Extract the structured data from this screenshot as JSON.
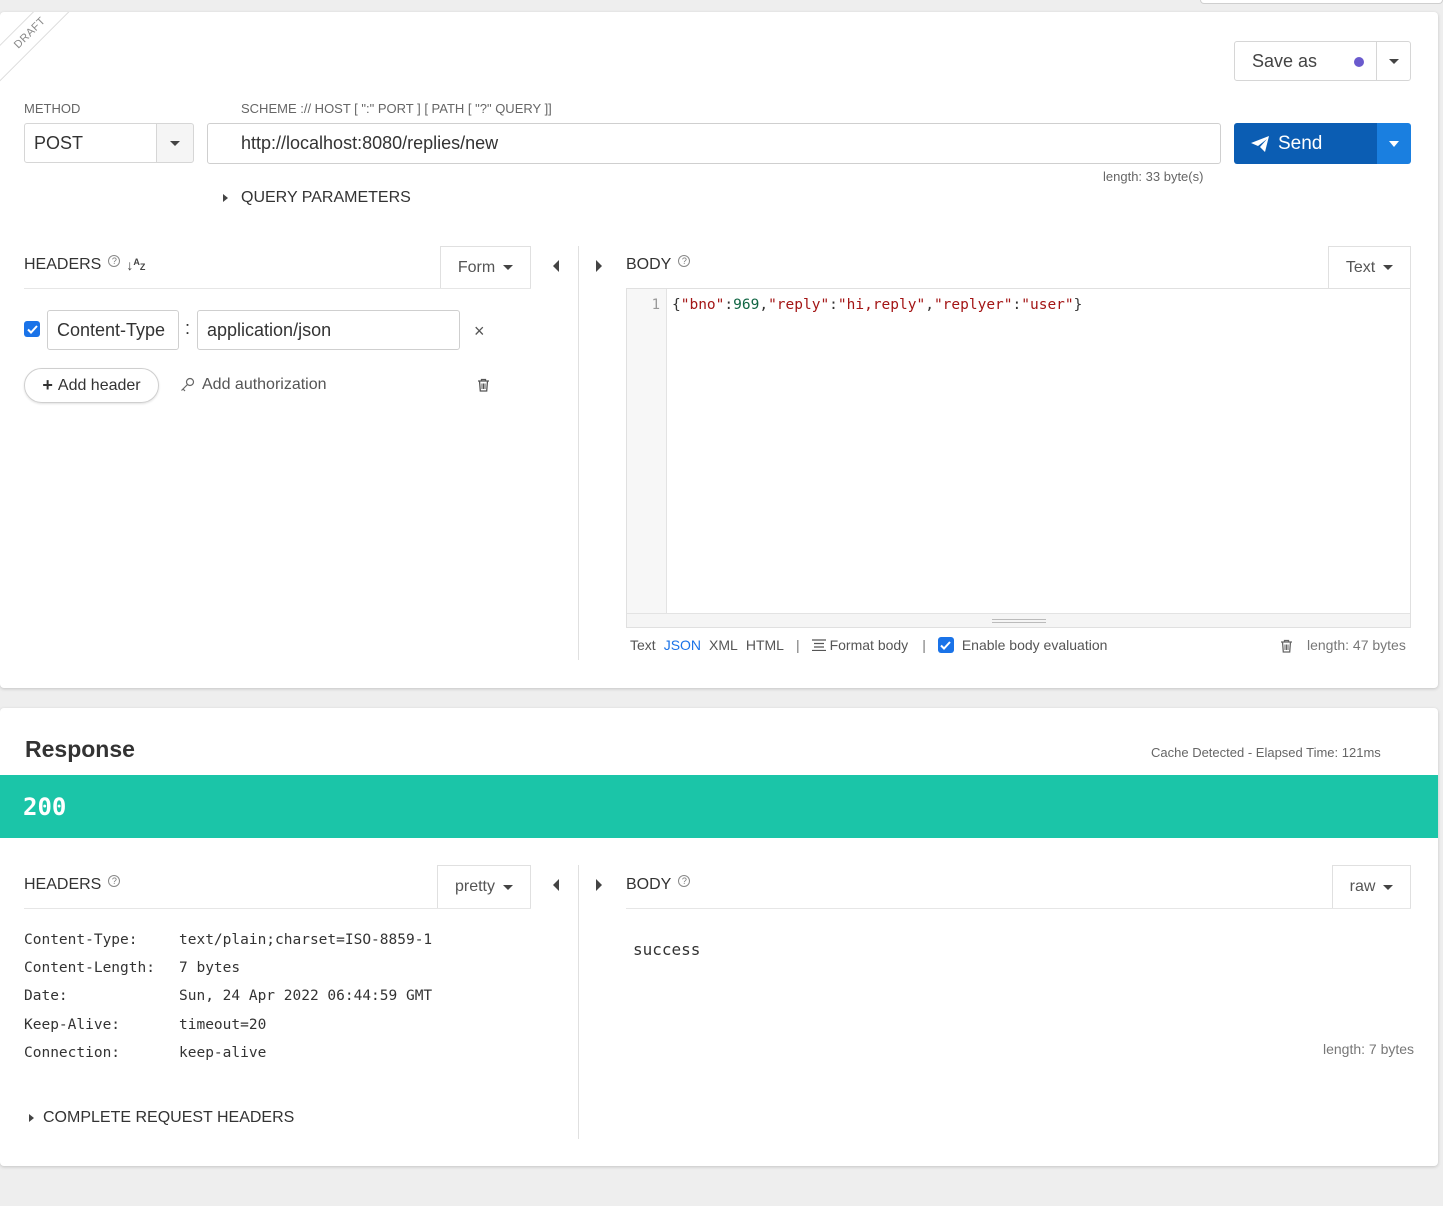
{
  "request": {
    "draft_label": "DRAFT",
    "save_as_label": "Save as",
    "method_label": "METHOD",
    "method_value": "POST",
    "url_label": "SCHEME :// HOST [ \":\" PORT ] [ PATH [ \"?\" QUERY ]]",
    "url_value": "http://localhost:8080/replies/new",
    "send_label": "Send",
    "url_length": "length: 33 byte(s)",
    "query_params_label": "QUERY PARAMETERS",
    "headers_label": "HEADERS",
    "headers_mode": "Form",
    "header_name": "Content-Type",
    "header_colon": ":",
    "header_value": "application/json",
    "add_header_label": "Add header",
    "add_auth_label": "Add authorization",
    "body_label": "BODY",
    "body_mode": "Text",
    "body_line_number": "1",
    "body_tokens": {
      "open": "{",
      "k1": "\"bno\"",
      "c1": ":",
      "v1": "969",
      "s1": ",",
      "k2": "\"reply\"",
      "c2": ":",
      "v2": "\"hi,reply\"",
      "s2": ",",
      "k3": "\"replyer\"",
      "c3": ":",
      "v3": "\"user\"",
      "close": "}"
    },
    "format_text": "Text",
    "format_json": "JSON",
    "format_xml": "XML",
    "format_html": "HTML",
    "sep": "|",
    "format_body_label": "Format body",
    "enable_eval_label": "Enable body evaluation",
    "body_length": "length: 47 bytes"
  },
  "response": {
    "title": "Response",
    "meta": "Cache Detected - Elapsed Time: 121ms",
    "status_code": "200",
    "status_color": "#1bc5a8",
    "headers_label": "HEADERS",
    "headers_mode": "pretty",
    "headers": [
      {
        "name": "Content-Type:",
        "value": "text/plain;charset=ISO-8859-1"
      },
      {
        "name": "Content-Length:",
        "value": "7 bytes"
      },
      {
        "name": "Date:",
        "value": "Sun, 24 Apr 2022 06:44:59 GMT"
      },
      {
        "name": "Keep-Alive:",
        "value": "timeout=20"
      },
      {
        "name": "Connection:",
        "value": "keep-alive"
      }
    ],
    "complete_headers_label": "COMPLETE REQUEST HEADERS",
    "body_label": "BODY",
    "body_mode": "raw",
    "body_text": "success",
    "body_length": "length: 7 bytes"
  },
  "colors": {
    "send_button": "#0b5db3",
    "accent_link": "#1a73e8",
    "save_dot": "#6a5acd"
  }
}
